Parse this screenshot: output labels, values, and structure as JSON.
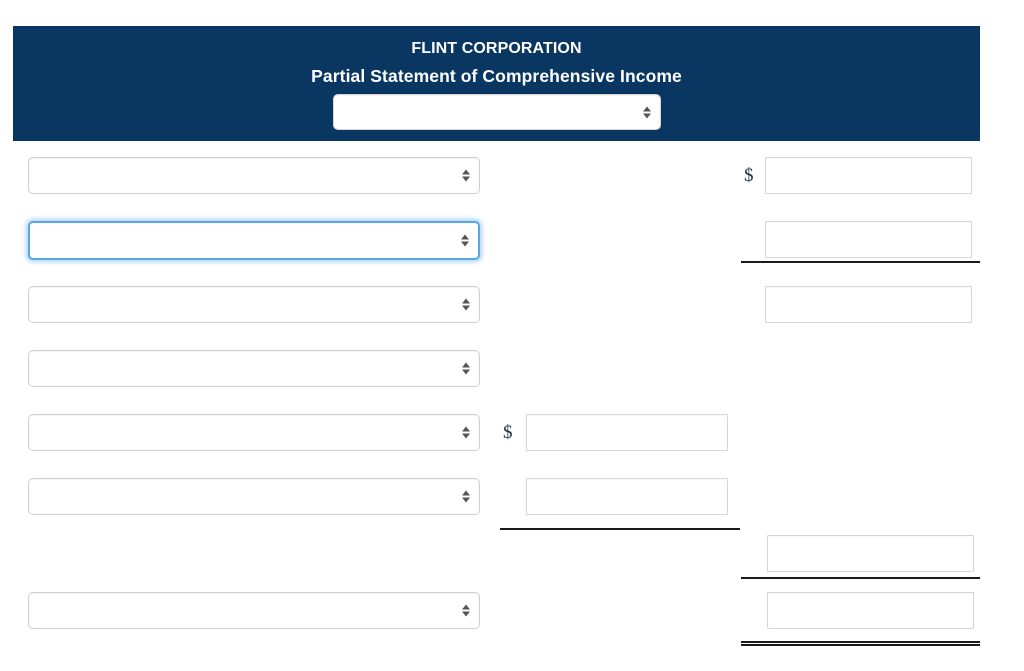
{
  "header": {
    "company_name": "FLINT CORPORATION",
    "statement_title": "Partial Statement of Comprehensive Income",
    "band_color": "#0a3761",
    "title_color": "#ffffff",
    "period_select": {
      "value": "",
      "placeholder": ""
    }
  },
  "currency_symbols": {
    "right_column_symbol": "$",
    "middle_column_symbol": "$"
  },
  "line_items": [
    {
      "label_select_value": "",
      "focused": false
    },
    {
      "label_select_value": "",
      "focused": true
    },
    {
      "label_select_value": "",
      "focused": false
    },
    {
      "label_select_value": "",
      "focused": false
    },
    {
      "label_select_value": "",
      "focused": false
    },
    {
      "label_select_value": "",
      "focused": false
    },
    {
      "label_select_value": "",
      "focused": false
    }
  ],
  "middle_amounts": [
    {
      "value": ""
    },
    {
      "value": ""
    }
  ],
  "right_amounts": [
    {
      "value": ""
    },
    {
      "value": ""
    },
    {
      "value": ""
    },
    {
      "value": ""
    },
    {
      "value": ""
    }
  ],
  "rules": {
    "subtotal_rule_style": "single",
    "grand_total_rule_style": "double",
    "rule_color": "#1a1a1a"
  },
  "focus": {
    "focused_control": "line-item-select-2",
    "focus_ring_color": "#55a8ea"
  }
}
